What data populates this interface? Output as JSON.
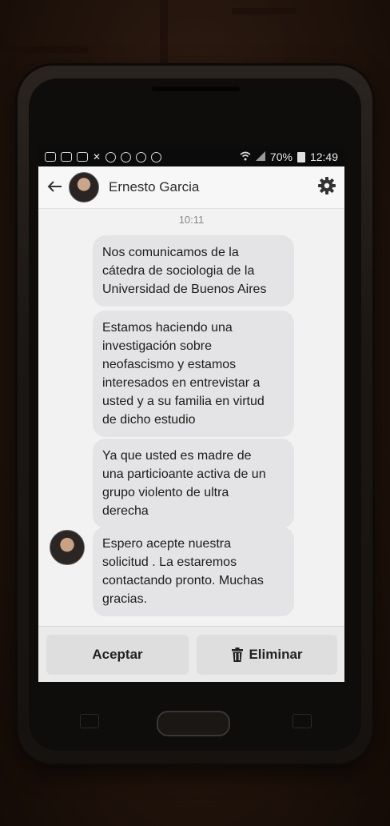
{
  "status_bar": {
    "battery": "70%",
    "time": "12:49",
    "left_icons": [
      "chat-icon",
      "photo-icon",
      "tv-icon",
      "missed-call-icon",
      "instagram-icon",
      "instagram-icon",
      "facebook-icon",
      "instagram-icon"
    ]
  },
  "header": {
    "contact_name": "Ernesto Garcia"
  },
  "conversation": {
    "timestamp": "10:11",
    "messages": [
      {
        "line1": "Nos comunicamos de la",
        "line2": "cátedra de sociologia de la",
        "line3": "Universidad de Buenos Aires"
      },
      {
        "line1": "Estamos haciendo una",
        "line2": "investigación sobre",
        "line3": "neofascismo y estamos",
        "line4": "interesados en entrevistar a",
        "line5": "usted y a su familia en virtud",
        "line6": "de dicho estudio"
      },
      {
        "line1": "Ya que usted es madre de",
        "line2": "una particioante activa de un",
        "line3": "grupo violento de ultra",
        "line4": "derecha"
      },
      {
        "line1": "Espero acepte nuestra",
        "line2": "solicitud . La estaremos",
        "line3": "contactando pronto. Muchas",
        "line4": "gracias."
      }
    ]
  },
  "actions": {
    "accept_label": "Aceptar",
    "delete_label": "Eliminar"
  }
}
